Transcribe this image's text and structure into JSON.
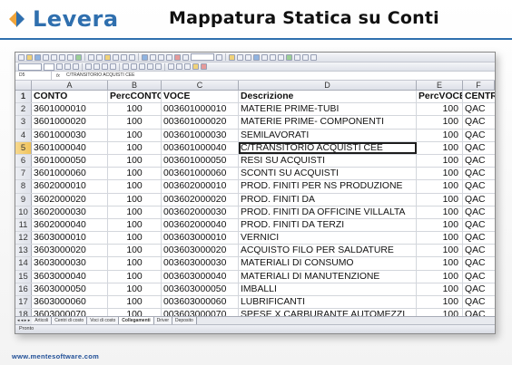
{
  "slide": {
    "logo_text": "Levera",
    "title": "Mappatura Statica su Conti",
    "footer_url": "www.mentesoftware.com"
  },
  "formula_bar": {
    "name_box": "D5",
    "fx": "fx",
    "content": "C/TRANSITORIO ACQUISTI CEE"
  },
  "grid": {
    "column_letters": [
      "A",
      "B",
      "C",
      "D",
      "E",
      "F"
    ],
    "selected_cell": "D5",
    "rows": [
      {
        "n": "1",
        "a": "CONTO",
        "b": "PercCONTO",
        "c": "VOCE",
        "d": "Descrizione",
        "e": "PercVOCE",
        "f": "CENTRO"
      },
      {
        "n": "2",
        "a": "3601000010",
        "b": "100",
        "c": "003601000010",
        "d": "MATERIE PRIME-TUBI",
        "e": "100",
        "f": "QAC"
      },
      {
        "n": "3",
        "a": "3601000020",
        "b": "100",
        "c": "003601000020",
        "d": "MATERIE PRIME- COMPONENTI",
        "e": "100",
        "f": "QAC"
      },
      {
        "n": "4",
        "a": "3601000030",
        "b": "100",
        "c": "003601000030",
        "d": "SEMILAVORATI",
        "e": "100",
        "f": "QAC"
      },
      {
        "n": "5",
        "a": "3601000040",
        "b": "100",
        "c": "003601000040",
        "d": "C/TRANSITORIO ACQUISTI CEE",
        "e": "100",
        "f": "QAC"
      },
      {
        "n": "6",
        "a": "3601000050",
        "b": "100",
        "c": "003601000050",
        "d": "RESI SU ACQUISTI",
        "e": "100",
        "f": "QAC"
      },
      {
        "n": "7",
        "a": "3601000060",
        "b": "100",
        "c": "003601000060",
        "d": "SCONTI SU ACQUISTI",
        "e": "100",
        "f": "QAC"
      },
      {
        "n": "8",
        "a": "3602000010",
        "b": "100",
        "c": "003602000010",
        "d": "PROD. FINITI PER NS PRODUZIONE",
        "e": "100",
        "f": "QAC"
      },
      {
        "n": "9",
        "a": "3602000020",
        "b": "100",
        "c": "003602000020",
        "d": "PROD. FINITI DA",
        "e": "100",
        "f": "QAC"
      },
      {
        "n": "10",
        "a": "3602000030",
        "b": "100",
        "c": "003602000030",
        "d": "PROD. FINITI DA OFFICINE VILLALTA",
        "e": "100",
        "f": "QAC"
      },
      {
        "n": "11",
        "a": "3602000040",
        "b": "100",
        "c": "003602000040",
        "d": "PROD. FINITI DA TERZI",
        "e": "100",
        "f": "QAC"
      },
      {
        "n": "12",
        "a": "3603000010",
        "b": "100",
        "c": "003603000010",
        "d": "VERNICI",
        "e": "100",
        "f": "QAC"
      },
      {
        "n": "13",
        "a": "3603000020",
        "b": "100",
        "c": "003603000020",
        "d": "ACQUISTO FILO PER SALDATURE",
        "e": "100",
        "f": "QAC"
      },
      {
        "n": "14",
        "a": "3603000030",
        "b": "100",
        "c": "003603000030",
        "d": "MATERIALI DI CONSUMO",
        "e": "100",
        "f": "QAC"
      },
      {
        "n": "15",
        "a": "3603000040",
        "b": "100",
        "c": "003603000040",
        "d": "MATERIALI DI MANUTENZIONE",
        "e": "100",
        "f": "QAC"
      },
      {
        "n": "16",
        "a": "3603000050",
        "b": "100",
        "c": "003603000050",
        "d": "IMBALLI",
        "e": "100",
        "f": "QAC"
      },
      {
        "n": "17",
        "a": "3603000060",
        "b": "100",
        "c": "003603000060",
        "d": "LUBRIFICANTI",
        "e": "100",
        "f": "QAC"
      },
      {
        "n": "18",
        "a": "3603000070",
        "b": "100",
        "c": "003603000070",
        "d": "SPESE X CARBURANTE AUTOMEZZI",
        "e": "100",
        "f": "QAC"
      }
    ]
  },
  "sheet_tabs": {
    "nav": "◂ ◂ ▸ ▸",
    "tabs": [
      "Articoli",
      "Centri di costo",
      "Voci di costo",
      "Collegamenti",
      "Driver",
      "Deposito"
    ],
    "active_index": 3
  },
  "status": "Pronto",
  "colors": {
    "brand_blue": "#2f6fae",
    "brand_orange": "#f0a43a",
    "selected_row_header": "#f0c35b"
  }
}
